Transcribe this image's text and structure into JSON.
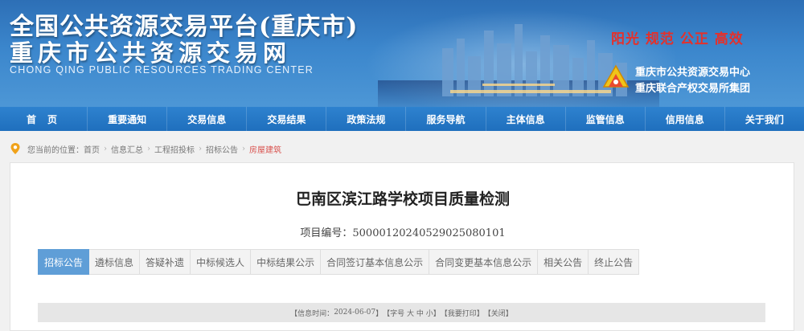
{
  "header": {
    "title": "全国公共资源交易平台(重庆市)",
    "subtitle": "重庆市公共资源交易网",
    "english": "CHONG QING PUBLIC RESOURCES TRADING CENTER",
    "slogan": "阳光 规范 公正 高效",
    "org_line1": "重庆市公共资源交易中心",
    "org_line2": "重庆联合产权交易所集团",
    "colors": {
      "banner": "#3b86cc",
      "slogan": "#e5302a",
      "nav": "#1f6fbd"
    }
  },
  "nav": {
    "items": [
      "首页",
      "重要通知",
      "交易信息",
      "交易结果",
      "政策法规",
      "服务导航",
      "主体信息",
      "监管信息",
      "信用信息",
      "关于我们"
    ]
  },
  "breadcrumb": {
    "prefix": "您当前的位置：",
    "items": [
      "首页",
      "信息汇总",
      "工程招投标",
      "招标公告",
      "房屋建筑"
    ],
    "separator": "›"
  },
  "project": {
    "title": "巴南区滨江路学校项目质量检测",
    "code_label": "项目编号：",
    "code": "500001202405290250801​01"
  },
  "tabs": {
    "active_index": 0,
    "items": [
      "招标公告",
      "遴标信息",
      "答疑补遗",
      "中标候选人",
      "中标结果公示",
      "合同签订基本信息公示",
      "合同变更基本信息公示",
      "相关公告",
      "终止公告"
    ],
    "active_color": "#5f9ed7"
  },
  "infobar": {
    "time_label": "【信息时间：",
    "time": "2024-06-07",
    "time_close": "】",
    "font_label": "【字号 ",
    "font_big": "大",
    "font_mid": "中",
    "font_small": "小",
    "font_close": "】",
    "print": "【我要打印】",
    "close": "【关闭】"
  }
}
